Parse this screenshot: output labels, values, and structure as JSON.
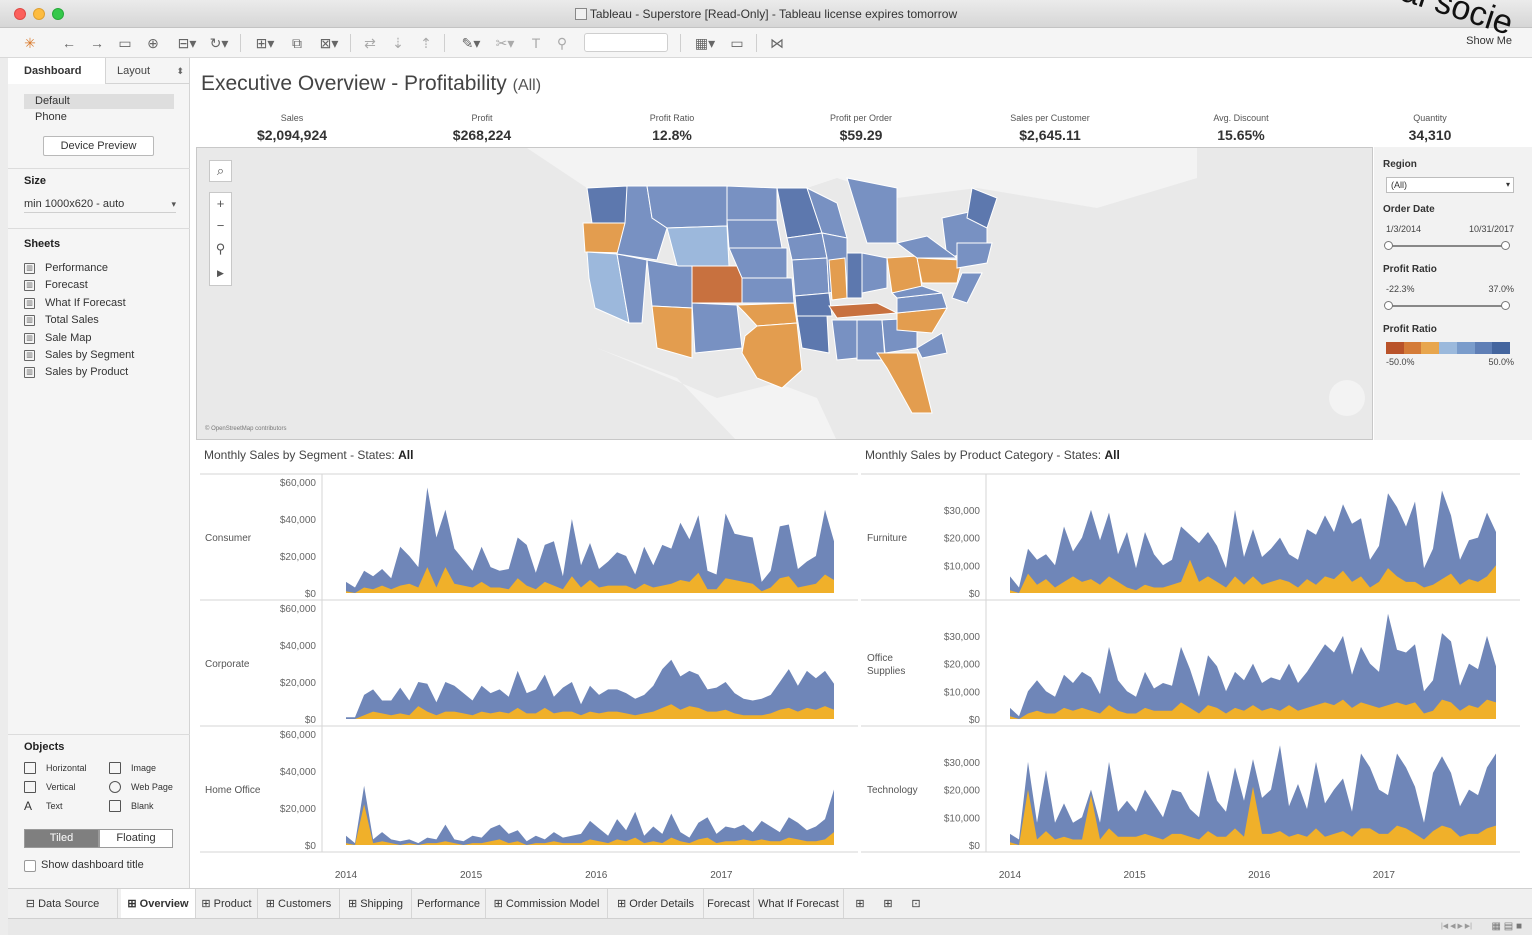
{
  "window": {
    "title": "Tableau - Superstore [Read-Only] - Tableau license expires tomorrow"
  },
  "toolbar": {
    "show_me": "Show Me"
  },
  "sidebar": {
    "tabs": [
      "Dashboard",
      "Layout"
    ],
    "devices": [
      "Default",
      "Phone"
    ],
    "device_preview": "Device Preview",
    "size_heading": "Size",
    "size_value": "min 1000x620 - auto",
    "sheets_heading": "Sheets",
    "sheets": [
      "Performance",
      "Forecast",
      "What If Forecast",
      "Total Sales",
      "Sale Map",
      "Sales by Segment",
      "Sales by Product"
    ],
    "objects_heading": "Objects",
    "objects": [
      "Horizontal",
      "Image",
      "Vertical",
      "Web Page",
      "Text",
      "Blank"
    ],
    "tiled": "Tiled",
    "floating": "Floating",
    "show_title": "Show dashboard title"
  },
  "dashboard": {
    "title": "Executive Overview - Profitability",
    "title_suffix": "(All)",
    "kpis": [
      {
        "label": "Sales",
        "value": "$2,094,924"
      },
      {
        "label": "Profit",
        "value": "$268,224"
      },
      {
        "label": "Profit Ratio",
        "value": "12.8%"
      },
      {
        "label": "Profit per Order",
        "value": "$59.29"
      },
      {
        "label": "Sales per Customer",
        "value": "$2,645.11"
      },
      {
        "label": "Avg. Discount",
        "value": "15.65%"
      },
      {
        "label": "Quantity",
        "value": "34,310"
      }
    ],
    "map_attribution": "© OpenStreetMap contributors",
    "filters": {
      "region_title": "Region",
      "region_value": "(All)",
      "order_date_title": "Order Date",
      "order_date_min": "1/3/2014",
      "order_date_max": "10/31/2017",
      "profit_ratio_title": "Profit Ratio",
      "profit_ratio_min": "-22.3%",
      "profit_ratio_max": "37.0%",
      "legend_title": "Profit Ratio",
      "legend_min": "-50.0%",
      "legend_max": "50.0%",
      "legend_colors": [
        "#b9532a",
        "#d47b38",
        "#e8a64d",
        "#9bb9dc",
        "#7a9ccb",
        "#5f7fb6",
        "#44659e"
      ]
    },
    "chart_left_title": "Monthly Sales by Segment - States: ",
    "chart_right_title": "Monthly Sales by Product Category - States: ",
    "chart_state": "All"
  },
  "colors": {
    "sales": "#6f86b8",
    "profit": "#f0b02a",
    "map_blue": "#7891c2",
    "map_orange": "#e39d4f",
    "map_dark_orange": "#c8713f"
  },
  "sheet_tabs": [
    "Data Source",
    "Overview",
    "Product",
    "Customers",
    "Shipping",
    "Performance",
    "Commission Model",
    "Order Details",
    "Forecast",
    "What If Forecast"
  ],
  "chart_data": [
    {
      "type": "area",
      "title": "Monthly Sales by Segment - States: All",
      "x": [
        "2014",
        "2015",
        "2016",
        "2017"
      ],
      "series_rows": [
        {
          "name": "Consumer",
          "ylim": [
            0,
            60000
          ],
          "yticks": [
            "$60,000",
            "$40,000",
            "$20,000",
            "$0"
          ],
          "sales": [
            6,
            3,
            12,
            9,
            13,
            8,
            25,
            20,
            14,
            57,
            30,
            45,
            24,
            18,
            12,
            25,
            14,
            12,
            13,
            30,
            26,
            11,
            26,
            28,
            9,
            40,
            15,
            27,
            13,
            17,
            22,
            20,
            10,
            25,
            15,
            26,
            24,
            38,
            29,
            42,
            12,
            10,
            43,
            32,
            31,
            30,
            6,
            12,
            36,
            37,
            13,
            17,
            20,
            45,
            28
          ],
          "profit": [
            1,
            0,
            3,
            2,
            4,
            2,
            4,
            5,
            3,
            14,
            3,
            14,
            5,
            4,
            3,
            6,
            3,
            3,
            2,
            8,
            4,
            2,
            6,
            4,
            2,
            9,
            3,
            7,
            3,
            4,
            4,
            4,
            2,
            5,
            3,
            4,
            5,
            7,
            6,
            11,
            2,
            2,
            8,
            7,
            6,
            5,
            1,
            3,
            8,
            9,
            3,
            4,
            5,
            10,
            7
          ]
        },
        {
          "name": "Corporate",
          "ylim": [
            0,
            60000
          ],
          "yticks": [
            "$60,000",
            "$40,000",
            "$20,000",
            "$0"
          ],
          "sales": [
            1,
            1,
            13,
            16,
            10,
            10,
            17,
            10,
            20,
            19,
            9,
            20,
            18,
            14,
            10,
            18,
            14,
            16,
            12,
            26,
            14,
            16,
            24,
            12,
            17,
            20,
            8,
            18,
            13,
            16,
            16,
            14,
            11,
            13,
            18,
            27,
            32,
            23,
            26,
            24,
            16,
            17,
            20,
            14,
            11,
            10,
            11,
            13,
            20,
            27,
            18,
            26,
            22,
            26,
            19
          ],
          "profit": [
            0,
            0,
            2,
            4,
            3,
            2,
            3,
            2,
            7,
            4,
            2,
            4,
            4,
            3,
            2,
            4,
            3,
            4,
            3,
            6,
            3,
            3,
            6,
            3,
            4,
            4,
            2,
            4,
            3,
            4,
            4,
            3,
            2,
            3,
            4,
            6,
            8,
            5,
            7,
            6,
            4,
            4,
            5,
            3,
            2,
            2,
            2,
            3,
            5,
            6,
            4,
            6,
            5,
            7,
            5
          ]
        },
        {
          "name": "Home Office",
          "ylim": [
            0,
            60000
          ],
          "yticks": [
            "$60,000",
            "$40,000",
            "$20,000",
            "$0"
          ],
          "sales": [
            5,
            1,
            32,
            3,
            7,
            3,
            2,
            3,
            1,
            4,
            3,
            11,
            3,
            2,
            5,
            4,
            9,
            11,
            6,
            8,
            2,
            5,
            3,
            7,
            4,
            5,
            6,
            13,
            9,
            5,
            14,
            8,
            18,
            5,
            10,
            6,
            17,
            7,
            4,
            12,
            15,
            6,
            10,
            9,
            11,
            7,
            13,
            10,
            7,
            15,
            12,
            8,
            10,
            14,
            30
          ],
          "profit": [
            1,
            0,
            22,
            1,
            2,
            1,
            0,
            1,
            0,
            1,
            1,
            2,
            1,
            0,
            1,
            1,
            2,
            3,
            1,
            2,
            0,
            1,
            1,
            2,
            1,
            1,
            1,
            3,
            2,
            1,
            3,
            2,
            4,
            1,
            2,
            1,
            4,
            2,
            1,
            3,
            4,
            1,
            2,
            2,
            3,
            2,
            3,
            2,
            2,
            4,
            3,
            2,
            2,
            3,
            7
          ]
        }
      ]
    },
    {
      "type": "area",
      "title": "Monthly Sales by Product Category - States: All",
      "x": [
        "2014",
        "2015",
        "2016",
        "2017"
      ],
      "series_rows": [
        {
          "name": "Furniture",
          "ylim": [
            0,
            35000
          ],
          "yticks": [
            "$30,000",
            "$20,000",
            "$10,000",
            "$0"
          ],
          "sales": [
            6,
            2,
            16,
            12,
            14,
            10,
            24,
            15,
            20,
            30,
            19,
            29,
            14,
            22,
            9,
            22,
            14,
            10,
            12,
            24,
            21,
            18,
            22,
            17,
            9,
            30,
            13,
            23,
            13,
            16,
            20,
            14,
            12,
            23,
            21,
            28,
            22,
            32,
            25,
            27,
            12,
            17,
            36,
            31,
            24,
            33,
            9,
            16,
            37,
            28,
            12,
            19,
            20,
            29,
            22
          ],
          "profit": [
            1,
            0,
            7,
            3,
            5,
            2,
            4,
            6,
            4,
            5,
            3,
            6,
            4,
            2,
            1,
            3,
            2,
            2,
            3,
            4,
            12,
            4,
            6,
            4,
            2,
            6,
            3,
            6,
            3,
            4,
            5,
            4,
            2,
            5,
            3,
            6,
            5,
            8,
            4,
            6,
            2,
            4,
            9,
            6,
            4,
            4,
            2,
            3,
            5,
            7,
            3,
            5,
            4,
            6,
            10
          ]
        },
        {
          "name": "Office Supplies",
          "ylim": [
            0,
            35000
          ],
          "yticks": [
            "$30,000",
            "$20,000",
            "$10,000",
            "$0"
          ],
          "sales": [
            4,
            1,
            10,
            14,
            10,
            8,
            16,
            13,
            17,
            15,
            9,
            26,
            14,
            10,
            8,
            17,
            11,
            13,
            12,
            26,
            18,
            8,
            23,
            19,
            10,
            17,
            14,
            20,
            13,
            15,
            14,
            20,
            13,
            17,
            22,
            27,
            24,
            30,
            16,
            26,
            20,
            17,
            38,
            25,
            24,
            27,
            10,
            14,
            31,
            28,
            12,
            20,
            18,
            30,
            19
          ],
          "profit": [
            1,
            0,
            2,
            3,
            2,
            2,
            4,
            3,
            4,
            3,
            2,
            5,
            3,
            2,
            2,
            4,
            3,
            3,
            3,
            6,
            4,
            2,
            5,
            4,
            2,
            4,
            3,
            5,
            3,
            4,
            3,
            5,
            3,
            4,
            5,
            6,
            5,
            7,
            4,
            6,
            5,
            4,
            5,
            6,
            5,
            6,
            2,
            3,
            7,
            6,
            3,
            5,
            4,
            7,
            6
          ]
        },
        {
          "name": "Technology",
          "ylim": [
            0,
            35000
          ],
          "yticks": [
            "$30,000",
            "$20,000",
            "$10,000",
            "$0"
          ],
          "sales": [
            4,
            2,
            30,
            8,
            27,
            8,
            15,
            8,
            10,
            20,
            8,
            30,
            12,
            16,
            12,
            20,
            15,
            10,
            20,
            19,
            13,
            10,
            27,
            16,
            12,
            28,
            16,
            31,
            17,
            20,
            36,
            14,
            22,
            13,
            30,
            15,
            20,
            24,
            12,
            33,
            28,
            20,
            18,
            33,
            28,
            21,
            8,
            26,
            32,
            26,
            14,
            20,
            18,
            28,
            33
          ],
          "profit": [
            1,
            0,
            20,
            2,
            5,
            2,
            3,
            2,
            2,
            18,
            2,
            6,
            3,
            3,
            3,
            4,
            3,
            2,
            4,
            4,
            3,
            2,
            5,
            3,
            3,
            6,
            3,
            21,
            4,
            4,
            5,
            3,
            4,
            3,
            6,
            3,
            4,
            5,
            3,
            6,
            6,
            4,
            4,
            7,
            6,
            4,
            2,
            5,
            7,
            6,
            3,
            4,
            4,
            6,
            7
          ]
        }
      ]
    }
  ]
}
